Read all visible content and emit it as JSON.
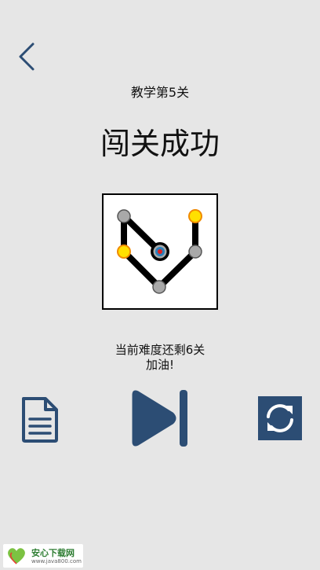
{
  "header": {
    "back_icon": "chevron-left-icon",
    "level_name": "教学第5关"
  },
  "result": {
    "title": "闯关成功"
  },
  "puzzle": {
    "nodes": [
      {
        "id": "n1",
        "type": "gray"
      },
      {
        "id": "n2",
        "type": "yellow"
      },
      {
        "id": "n3",
        "type": "target"
      },
      {
        "id": "n4",
        "type": "gray"
      },
      {
        "id": "n5",
        "type": "gray"
      },
      {
        "id": "n6",
        "type": "yellow"
      }
    ],
    "edges": [
      [
        "n1",
        "n2"
      ],
      [
        "n1",
        "n3"
      ],
      [
        "n2",
        "n4"
      ],
      [
        "n4",
        "n5"
      ],
      [
        "n5",
        "n6"
      ]
    ]
  },
  "status": {
    "remaining": "当前难度还剩6关",
    "cheer": "加油!"
  },
  "actions": {
    "doc_icon": "document-icon",
    "next_icon": "skip-next-icon",
    "restart_icon": "refresh-icon"
  },
  "watermark": {
    "name": "安心下载网",
    "url": "www.java800.com"
  },
  "colors": {
    "background": "#e6e6e6",
    "accent": "#2c4d74",
    "node_gray": "#a9a9a9",
    "node_yellow": "#ffe000",
    "node_ring_orange": "#f08a00",
    "target_red": "#e02020",
    "target_blue": "#2c7fb8"
  }
}
